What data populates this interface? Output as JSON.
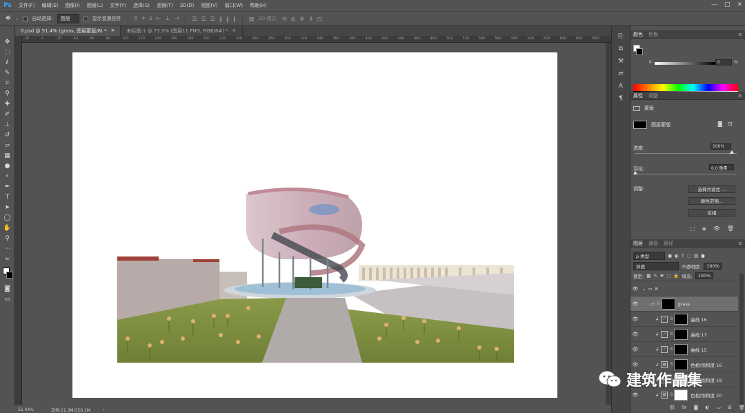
{
  "app": {
    "logo": "Ps"
  },
  "menu": [
    "文件(F)",
    "编辑(E)",
    "图像(I)",
    "图层(L)",
    "文字(Y)",
    "选择(S)",
    "滤镜(T)",
    "3D(D)",
    "视图(V)",
    "窗口(W)",
    "帮助(H)"
  ],
  "options": {
    "auto_select_label": "自动选择:",
    "auto_select_value": "图层",
    "show_transform_label": "显示变换控件",
    "mode_3d_label": "3D 模式:"
  },
  "tabs": [
    {
      "label": "0.psd @ 51.4% (grass, 图层蒙版/8) *",
      "close": "×"
    },
    {
      "label": "未标题-1 @ 73.3% (图层11.PNG, RGB/8#) *",
      "close": "×"
    }
  ],
  "ruler_ticks": [
    "20",
    "0",
    "20",
    "40",
    "60",
    "80",
    "100",
    "120",
    "140",
    "160",
    "180",
    "200",
    "220",
    "240",
    "260",
    "280",
    "300",
    "320",
    "340",
    "360",
    "380",
    "400",
    "420",
    "440",
    "460",
    "480",
    "500",
    "520",
    "540",
    "560",
    "580",
    "600",
    "620",
    "640",
    "660",
    "680"
  ],
  "status": {
    "zoom": "51.44%",
    "doc": "文档:11.3M/150.1M",
    "arrow": "›"
  },
  "color_panel": {
    "tabs": [
      "颜色",
      "色板"
    ],
    "k_label": "K",
    "k_value": "0",
    "k_unit": "%"
  },
  "properties": {
    "tabs": [
      "属性",
      "调整"
    ],
    "type_label": "蒙版",
    "mask_label": "图层蒙版",
    "density_label": "浓度:",
    "density_value": "100%",
    "feather_label": "羽化:",
    "feather_value": "0.0 像素",
    "adjust_label": "调整:",
    "buttons": [
      "选择并遮住 ...",
      "颜色范围...",
      "反相"
    ]
  },
  "layers_panel": {
    "tabs": [
      "图层",
      "通道",
      "路径"
    ],
    "filter_label": "ρ 类型",
    "blend_mode": "穿透",
    "opacity_label": "不透明度:",
    "opacity_value": "100%",
    "lock_label": "锁定:",
    "fill_label": "填充:",
    "fill_value": "100%",
    "layers": [
      {
        "name": "8",
        "kind": "group"
      },
      {
        "name": "grass",
        "kind": "layer"
      },
      {
        "name": "曲线 16",
        "kind": "adj"
      },
      {
        "name": "曲线 17",
        "kind": "adj"
      },
      {
        "name": "曲线 15",
        "kind": "adj"
      },
      {
        "name": "色相/饱和度 16",
        "kind": "adj"
      },
      {
        "name": "色相/饱和度 19",
        "kind": "adj"
      },
      {
        "name": "色相/饱和度 20",
        "kind": "adj"
      }
    ]
  },
  "watermark": {
    "text": "建筑作品集"
  }
}
